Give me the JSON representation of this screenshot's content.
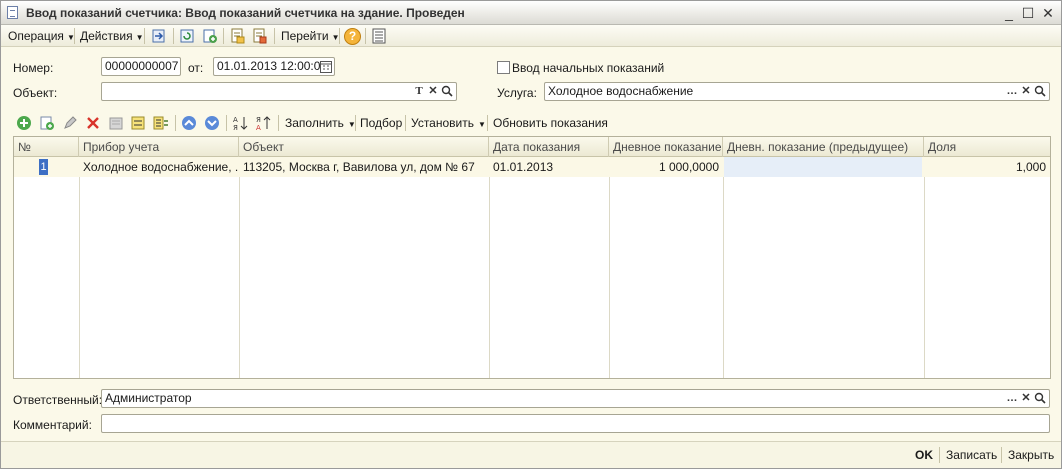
{
  "window": {
    "title": "Ввод показаний счетчика: Ввод показаний счетчика на здание. Проведен",
    "minimize": "_",
    "maximize": "☐",
    "close": "✕"
  },
  "menubar": {
    "operation": "Операция",
    "actions": "Действия",
    "goto": "Перейти",
    "help": "?"
  },
  "form": {
    "number_label": "Номер:",
    "number_value": "00000000007",
    "date_label": "от:",
    "date_value": "01.01.2013 12:00:05",
    "initial_checkbox_label": "Ввод начальных показаний",
    "object_label": "Объект:",
    "object_value": "",
    "service_label": "Услуга:",
    "service_value": "Холодное водоснабжение",
    "responsible_label": "Ответственный:",
    "responsible_value": "Администратор",
    "comment_label": "Комментарий:",
    "comment_value": ""
  },
  "field_buttons": {
    "type": "T",
    "clear": "✕",
    "select": "…"
  },
  "table_toolbar": {
    "fill": "Заполнить",
    "selection": "Подбор",
    "set": "Установить",
    "refresh": "Обновить показания"
  },
  "table": {
    "columns": [
      "№",
      "Прибор учета",
      "Объект",
      "Дата показания",
      "Дневное показание",
      "Дневн. показание (предыдущее)",
      "Доля"
    ],
    "rows": [
      {
        "n": "1",
        "device": "Холодное водоснабжение, ...",
        "object": "113205, Москва г, Вавилова ул, дом № 67",
        "date": "01.01.2013",
        "day_reading": "1 000,0000",
        "prev_reading": "",
        "share": "1,000"
      }
    ]
  },
  "footer": {
    "ok": "OK",
    "save": "Записать",
    "close": "Закрыть"
  }
}
